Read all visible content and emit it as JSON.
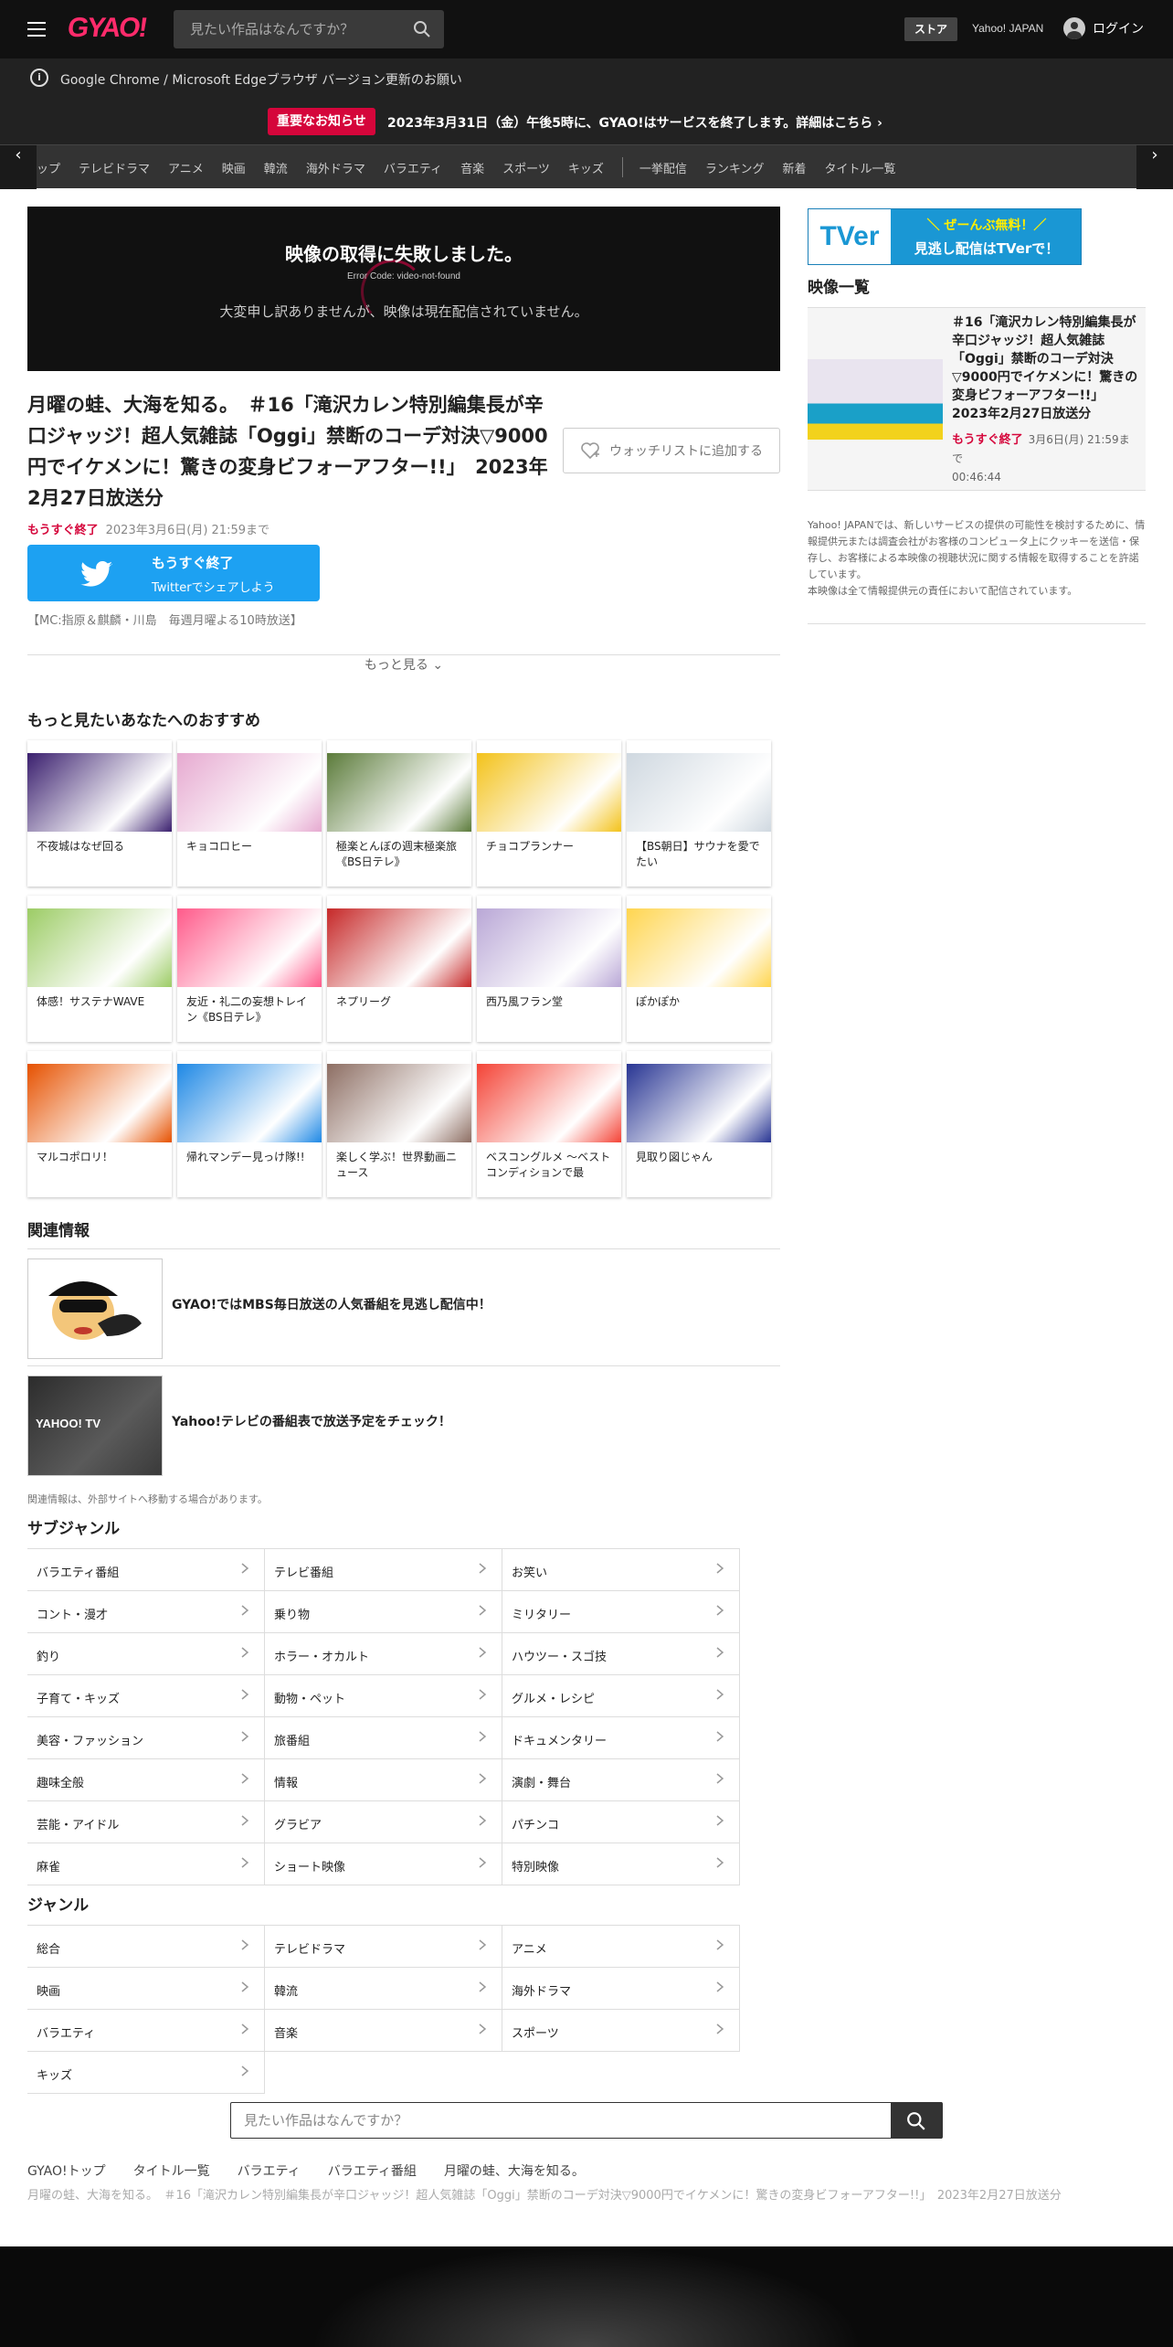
{
  "header": {
    "logo": "GYAO!",
    "search_placeholder": "見たい作品はなんですか？",
    "store": "ストア",
    "yahoo_japan": "Yahoo! JAPAN",
    "login": "ログイン"
  },
  "browser_notice": "Google Chrome / Microsoft Edgeブラウザ バージョン更新のお願い",
  "important": {
    "badge": "重要なお知らせ",
    "text": "2023年3月31日（金）午後5時に、GYAO!はサービスを終了します。詳細はこちら"
  },
  "nav": {
    "items": [
      "ップ",
      "テレビドラマ",
      "アニメ",
      "映画",
      "韓流",
      "海外ドラマ",
      "バラエティ",
      "音楽",
      "スポーツ",
      "キッズ"
    ],
    "items2": [
      "一挙配信",
      "ランキング",
      "新着",
      "タイトル一覧"
    ]
  },
  "player": {
    "error_title": "映像の取得に失敗しました。",
    "error_code": "Error Code: video-not-found",
    "error_message": "大変申し訳ありませんが、映像は現在配信されていません。"
  },
  "episode": {
    "title": "月曜の蛙、大海を知る。　＃16「滝沢カレン特別編集長が辛口ジャッジ！超人気雑誌「Oggi」禁断のコーデ対決▽9000円でイケメンに！驚きの変身ビフォーアフター!!」　2023年2月27日放送分",
    "watchlist": "ウォッチリストに追加する",
    "ending_label": "もうすぐ終了",
    "ending_date": "2023年3月6日(月) 21:59まで",
    "twitter_l1": "もうすぐ終了",
    "twitter_l2": "Twitterでシェアしよう",
    "mc": "【MC:指原＆麒麟・川島　毎週月曜よる10時放送】",
    "more": "もっと見る"
  },
  "recommend": {
    "title": "もっと見たいあなたへのおすすめ",
    "items": [
      {
        "label": "不夜城はなぜ回る",
        "color": "#3a1f6e"
      },
      {
        "label": "キョコロヒー",
        "color": "#e6a9d0"
      },
      {
        "label": "極楽とんぼの週末極楽旅《BS日テレ》",
        "color": "#5b7b3a"
      },
      {
        "label": "チョコプランナー",
        "color": "#f3c21a"
      },
      {
        "label": "【BS朝日】サウナを愛でたい",
        "color": "#cfd8e0"
      },
      {
        "label": "体感！サステナWAVE",
        "color": "#9ccc65"
      },
      {
        "label": "友近・礼二の妄想トレイン《BS日テレ》",
        "color": "#ff5a8a"
      },
      {
        "label": "ネプリーグ",
        "color": "#c62828"
      },
      {
        "label": "西乃風フラン堂",
        "color": "#b9a7d6"
      },
      {
        "label": "ぽかぽか",
        "color": "#ffd54f"
      },
      {
        "label": "マルコポロリ！",
        "color": "#e65100"
      },
      {
        "label": "帰れマンデー見っけ隊!!",
        "color": "#1e88e5"
      },
      {
        "label": "楽しく学ぶ！世界動画ニュース",
        "color": "#8d6e63"
      },
      {
        "label": "ベスコングルメ 〜ベストコンディションで最",
        "color": "#f44336"
      },
      {
        "label": "見取り図じゃん",
        "color": "#283593"
      }
    ]
  },
  "related": {
    "title": "関連情報",
    "items": [
      {
        "label": "GYAO!ではMBS毎日放送の人気番組を見逃し配信中！"
      },
      {
        "label": "Yahoo!テレビの番組表で放送予定をチェック！"
      }
    ],
    "note": "関連情報は、外部サイトへ移動する場合があります。"
  },
  "subgenre": {
    "title": "サブジャンル",
    "items": [
      "バラエティ番組",
      "テレビ番組",
      "お笑い",
      "コント・漫才",
      "乗り物",
      "ミリタリー",
      "釣り",
      "ホラー・オカルト",
      "ハウツー・スゴ技",
      "子育て・キッズ",
      "動物・ペット",
      "グルメ・レシピ",
      "美容・ファッション",
      "旅番組",
      "ドキュメンタリー",
      "趣味全般",
      "情報",
      "演劇・舞台",
      "芸能・アイドル",
      "グラビア",
      "パチンコ",
      "麻雀",
      "ショート映像",
      "特別映像"
    ]
  },
  "genre": {
    "title": "ジャンル",
    "items": [
      "総合",
      "テレビドラマ",
      "アニメ",
      "映画",
      "韓流",
      "海外ドラマ",
      "バラエティ",
      "音楽",
      "スポーツ",
      "キッズ"
    ]
  },
  "bottom_search_placeholder": "見たい作品はなんですか？",
  "breadcrumbs": [
    "GYAO!トップ",
    "タイトル一覧",
    "バラエティ",
    "バラエティ番組",
    "月曜の蛙、大海を知る。"
  ],
  "breadcrumb_current": "月曜の蛙、大海を知る。　＃16「滝沢カレン特別編集長が辛口ジャッジ！超人気雑誌「Oggi」禁断のコーデ対決▽9000円でイケメンに！驚きの変身ビフォーアフター!!」　2023年2月27日放送分",
  "sidebar": {
    "tver_logo": "TVer",
    "tver_l1": "＼ ぜーんぶ無料！／",
    "tver_l2": "見逃し配信はTVerで！",
    "list_title": "映像一覧",
    "item_title": "＃16「滝沢カレン特別編集長が辛口ジャッジ！超人気雑誌「Oggi」禁断のコーデ対決▽9000円でイケメンに！驚きの変身ビフォーアフター!!」　2023年2月27日放送分",
    "item_ending": "もうすぐ終了",
    "item_date": "3月6日(月) 21:59まで",
    "item_duration": "00:46:44",
    "disclaimer": "Yahoo! JAPANでは、新しいサービスの提供の可能性を検討するために、情報提供元または調査会社がお客様のコンピュータ上にクッキーを送信・保存し、お客様による本映像の視聴状況に関する情報を取得することを許諾しています。\n本映像は全て情報提供元の責任において配信されています。"
  }
}
